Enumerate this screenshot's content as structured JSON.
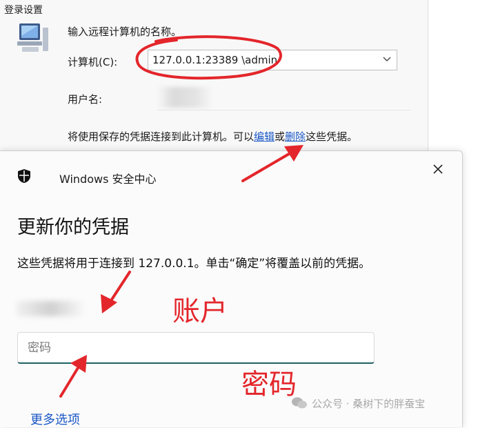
{
  "bg_dialog": {
    "title": "登录设置",
    "prompt": "输入远程计算机的名称。",
    "computer_label": "计算机(C):",
    "computer_value": "127.0.0.1:23389 \\admin",
    "username_label": "用户名:",
    "saved_prefix": "将使用保存的凭据连接到此计算机。可以",
    "edit_link": "编辑",
    "or_word": "或",
    "delete_link": "删除",
    "saved_suffix": "这些凭据。"
  },
  "security_dialog": {
    "app_name": "Windows 安全中心",
    "heading": "更新你的凭据",
    "description": "这些凭据将用于连接到 127.0.0.1。单击“确定”将覆盖以前的凭据。",
    "password_placeholder": "密码",
    "more_options": "更多选项"
  },
  "annotations": {
    "account": "账户",
    "password": "密码",
    "color": "#e3262b"
  },
  "watermark": "公众号 · 桑树下的胖蚕宝"
}
